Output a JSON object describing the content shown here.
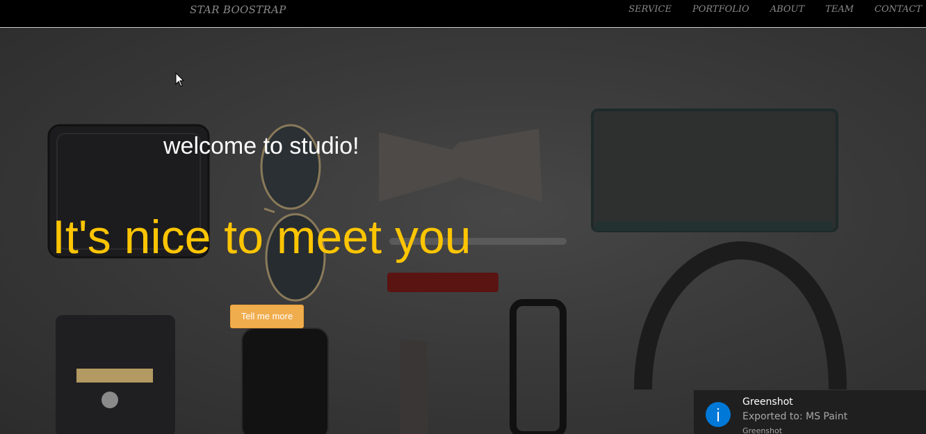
{
  "navbar": {
    "brand": "STAR BOOSTRAP",
    "links": [
      "SERVICE",
      "PORTFOLIO",
      "ABOUT",
      "TEAM",
      "CONTACT"
    ]
  },
  "hero": {
    "welcome": "welcome to studio!",
    "tagline": "It's nice to meet you",
    "cta_label": "Tell me more",
    "accent_color": "#fec503",
    "button_color": "#f0ad4e"
  },
  "notification": {
    "icon": "info-icon",
    "title": "Greenshot",
    "message": "Exported to: MS Paint",
    "app": "Greenshot"
  }
}
